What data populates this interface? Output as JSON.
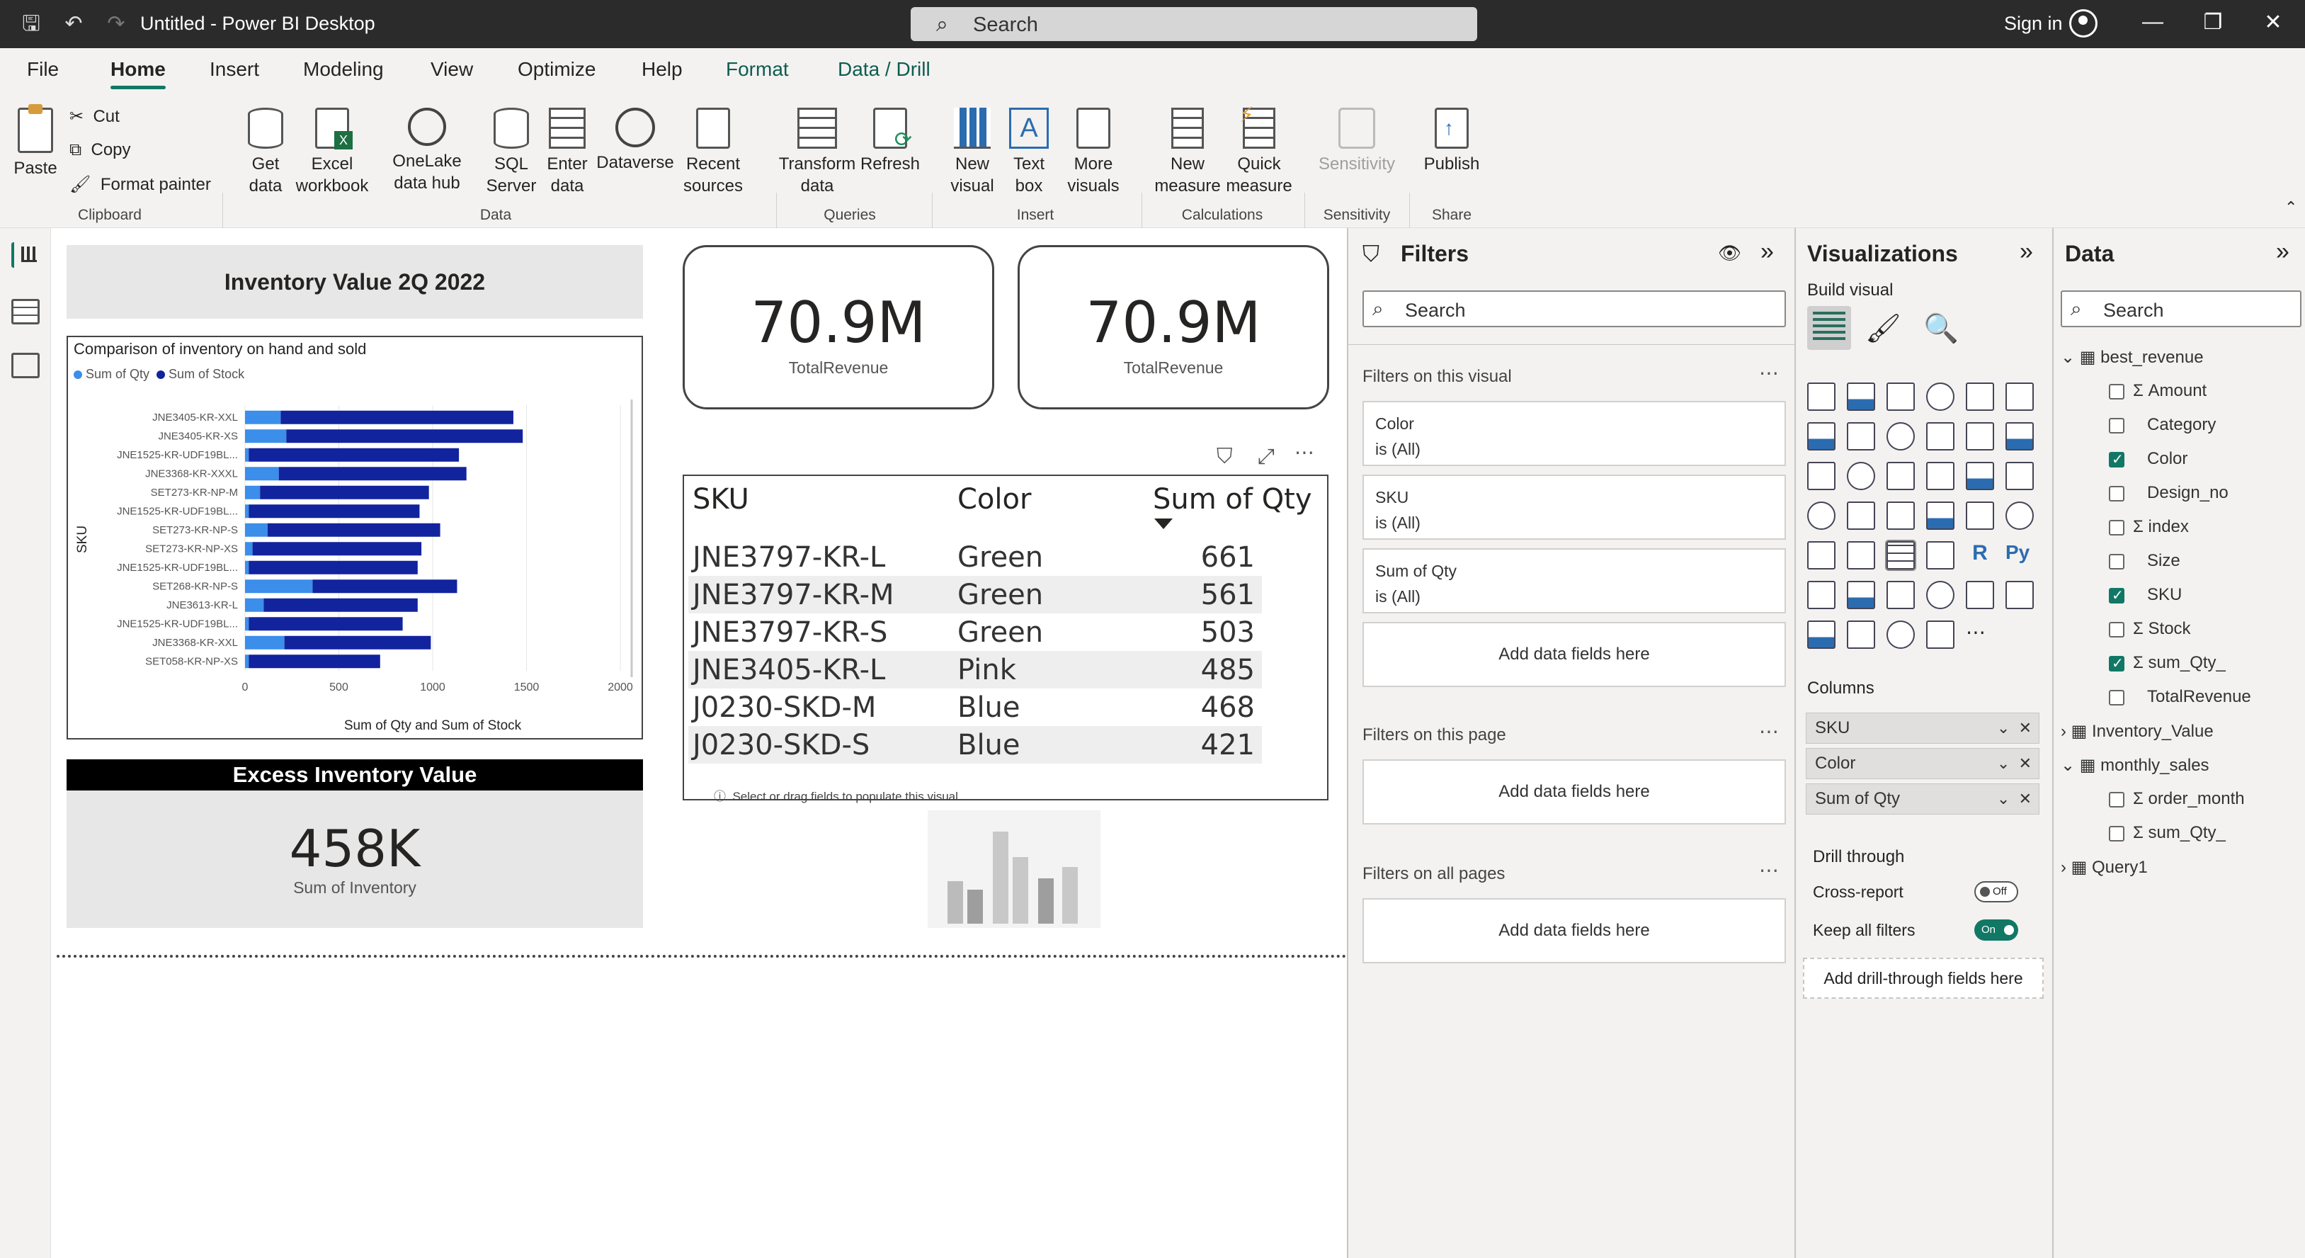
{
  "titlebar": {
    "app_title": "Untitled - Power BI Desktop",
    "search_placeholder": "Search",
    "signin": "Sign in"
  },
  "menu": [
    "File",
    "Home",
    "Insert",
    "Modeling",
    "View",
    "Optimize",
    "Help",
    "Format",
    "Data / Drill"
  ],
  "ribbon": {
    "paste": "Paste",
    "cut": "Cut",
    "copy": "Copy",
    "format_painter": "Format painter",
    "clipboard": "Clipboard",
    "get_data": "Get data",
    "excel": "Excel workbook",
    "onelake": "OneLake data hub",
    "sql": "SQL Server",
    "enter_data": "Enter data",
    "dataverse": "Dataverse",
    "recent": "Recent sources",
    "data_group": "Data",
    "transform": "Transform data",
    "refresh": "Refresh",
    "queries": "Queries",
    "new_visual": "New visual",
    "text_box": "Text box",
    "more_visuals": "More visuals",
    "insert": "Insert",
    "new_measure": "New measure",
    "quick_measure": "Quick measure",
    "calculations": "Calculations",
    "sensitivity": "Sensitivity",
    "sensitivity_group": "Sensitivity",
    "publish": "Publish",
    "share": "Share"
  },
  "canvas": {
    "inventory_title": "Inventory Value 2Q 2022",
    "card1": {
      "value": "70.9M",
      "label": "TotalRevenue"
    },
    "card2": {
      "value": "70.9M",
      "label": "TotalRevenue"
    },
    "excess_title": "Excess Inventory Value",
    "excess_value": "458K",
    "excess_label": "Sum of Inventory",
    "empty_hint": "Select or drag fields to populate this visual"
  },
  "chart_data": {
    "type": "bar",
    "title": "Comparison of inventory on hand and sold",
    "xlabel": "Sum of Qty and Sum of Stock",
    "ylabel": "SKU",
    "xlim": [
      0,
      2000
    ],
    "xticks": [
      "0",
      "500",
      "1000",
      "1500",
      "2000"
    ],
    "stacked": true,
    "legend": "top-left",
    "categories": [
      "JNE3405-KR-XXL",
      "JNE3405-KR-XS",
      "JNE1525-KR-UDF19BL...",
      "JNE3368-KR-XXXL",
      "SET273-KR-NP-M",
      "JNE1525-KR-UDF19BL...",
      "SET273-KR-NP-S",
      "SET273-KR-NP-XS",
      "JNE1525-KR-UDF19BL...",
      "SET268-KR-NP-S",
      "JNE3613-KR-L",
      "JNE1525-KR-UDF19BL...",
      "JNE3368-KR-XXL",
      "SET058-KR-NP-XS"
    ],
    "series": [
      {
        "name": "Sum of Qty",
        "color": "#3b8eea",
        "values": [
          190,
          220,
          20,
          180,
          80,
          20,
          120,
          40,
          20,
          360,
          100,
          20,
          210,
          20
        ]
      },
      {
        "name": "Sum of Stock",
        "color": "#12239e",
        "values": [
          1240,
          1260,
          1120,
          1000,
          900,
          910,
          920,
          900,
          900,
          770,
          820,
          820,
          780,
          700
        ]
      }
    ]
  },
  "table": {
    "headers": [
      "SKU",
      "Color",
      "Sum of Qty"
    ],
    "rows": [
      [
        "JNE3797-KR-L",
        "Green",
        "661"
      ],
      [
        "JNE3797-KR-M",
        "Green",
        "561"
      ],
      [
        "JNE3797-KR-S",
        "Green",
        "503"
      ],
      [
        "JNE3405-KR-L",
        "Pink",
        "485"
      ],
      [
        "J0230-SKD-M",
        "Blue",
        "468"
      ],
      [
        "J0230-SKD-S",
        "Blue",
        "421"
      ]
    ]
  },
  "filters": {
    "title": "Filters",
    "search": "Search",
    "on_visual": "Filters on this visual",
    "cards": [
      {
        "field": "Color",
        "state": "is (All)"
      },
      {
        "field": "SKU",
        "state": "is (All)"
      },
      {
        "field": "Sum of Qty",
        "state": "is (All)"
      }
    ],
    "add_fields": "Add data fields here",
    "on_page": "Filters on this page",
    "on_all": "Filters on all pages"
  },
  "viz": {
    "title": "Visualizations",
    "build_visual": "Build visual",
    "columns": "Columns",
    "wells": [
      "SKU",
      "Color",
      "Sum of Qty"
    ],
    "drill_through": "Drill through",
    "cross_report": "Cross-report",
    "cross_state": "Off",
    "keep_filters": "Keep all filters",
    "keep_state": "On",
    "add_drill": "Add drill-through fields here"
  },
  "datapane": {
    "title": "Data",
    "search": "Search",
    "tables": [
      {
        "name": "best_revenue",
        "fields": [
          {
            "name": "Amount",
            "sigma": true,
            "checked": false
          },
          {
            "name": "Category",
            "sigma": false,
            "checked": false
          },
          {
            "name": "Color",
            "sigma": false,
            "checked": true
          },
          {
            "name": "Design_no",
            "sigma": false,
            "checked": false
          },
          {
            "name": "index",
            "sigma": true,
            "checked": false
          },
          {
            "name": "Size",
            "sigma": false,
            "checked": false
          },
          {
            "name": "SKU",
            "sigma": false,
            "checked": true
          },
          {
            "name": "Stock",
            "sigma": true,
            "checked": false
          },
          {
            "name": "sum_Qty_",
            "sigma": true,
            "checked": true
          },
          {
            "name": "TotalRevenue",
            "sigma": false,
            "checked": false
          }
        ]
      },
      {
        "name": "Inventory_Value",
        "fields": []
      },
      {
        "name": "monthly_sales",
        "fields": [
          {
            "name": "order_month",
            "sigma": true,
            "checked": false
          },
          {
            "name": "sum_Qty_",
            "sigma": true,
            "checked": false
          }
        ]
      },
      {
        "name": "Query1",
        "fields": []
      }
    ]
  }
}
